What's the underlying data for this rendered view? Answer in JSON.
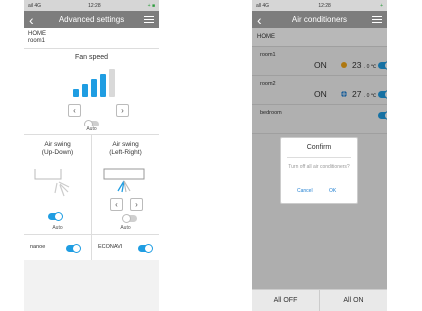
{
  "left": {
    "status": {
      "signal": "ail 4G",
      "time": "12:28",
      "battery": "+ ■"
    },
    "nav": {
      "title": "Advanced settings"
    },
    "location": {
      "home": "HOME",
      "room": "room1"
    },
    "fan": {
      "title": "Fan speed",
      "level": 4,
      "max": 5,
      "auto_label": "Auto",
      "auto_on": false
    },
    "swing_ud": {
      "title_1": "Air swing",
      "title_2": "(Up-Down)",
      "auto_label": "Auto",
      "auto_on": true
    },
    "swing_lr": {
      "title_1": "Air swing",
      "title_2": "(Left-Right)",
      "auto_label": "Auto",
      "auto_on": false
    },
    "nanoe": {
      "label": "nanoe",
      "on": true
    },
    "econavi": {
      "label": "ECONAVI",
      "on": true
    },
    "colors": {
      "accent": "#1f9de2",
      "nav": "#7d7d7d"
    }
  },
  "right": {
    "status": {
      "signal": "all 4G",
      "time": "12:28",
      "battery": "+"
    },
    "nav": {
      "title": "Air conditioners"
    },
    "home": "HOME",
    "rooms": [
      {
        "name": "room1",
        "status": "ON",
        "mode_icon": "sun-icon",
        "temp": "23",
        "unit": ". 0 ℃",
        "on": true
      },
      {
        "name": "room2",
        "status": "ON",
        "mode_icon": "snowflake-icon",
        "temp": "27",
        "unit": ". 0 ℃",
        "on": true
      },
      {
        "name": "bedroom",
        "status": "",
        "mode_icon": "",
        "temp": "",
        "unit": "",
        "on": true
      }
    ],
    "dialog": {
      "title": "Confirm",
      "message": "Turn off all air conditioners?",
      "cancel": "Cancel",
      "ok": "OK"
    },
    "footer": {
      "all_off": "All OFF",
      "all_on": "All ON"
    }
  }
}
